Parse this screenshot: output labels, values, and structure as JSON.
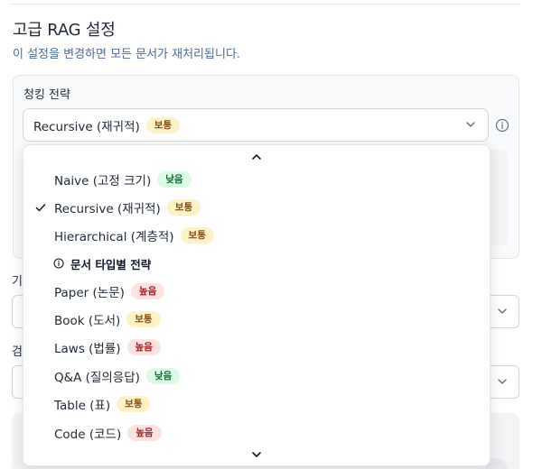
{
  "header": {
    "title": "고급 RAG 설정",
    "subtitle": "이 설정을 변경하면 모든 문서가 재처리됩니다."
  },
  "chunking": {
    "label": "청킹 전략",
    "selected_label": "Recursive (재귀적)",
    "selected_badge": "보통"
  },
  "background": {
    "label_1_partial": "기",
    "label_2_partial": "검"
  },
  "dropdown": {
    "options": [
      {
        "label": "Naive (고정 크기)",
        "badge": "낮음",
        "level": "low",
        "selected": false
      },
      {
        "label": "Recursive (재귀적)",
        "badge": "보통",
        "level": "mid",
        "selected": true
      },
      {
        "label": "Hierarchical (계층적)",
        "badge": "보통",
        "level": "mid",
        "selected": false
      }
    ],
    "group_label": "문서 타입별 전략",
    "typed_options": [
      {
        "label": "Paper (논문)",
        "badge": "높음",
        "level": "high"
      },
      {
        "label": "Book (도서)",
        "badge": "보통",
        "level": "mid"
      },
      {
        "label": "Laws (법률)",
        "badge": "높음",
        "level": "high"
      },
      {
        "label": "Q&A (질의응답)",
        "badge": "낮음",
        "level": "low"
      },
      {
        "label": "Table (표)",
        "badge": "보통",
        "level": "mid"
      },
      {
        "label": "Code (코드)",
        "badge": "높음",
        "level": "high"
      }
    ]
  },
  "colors": {
    "badge_mid_bg": "#fef3c7",
    "badge_low_bg": "#dcfce7",
    "badge_high_bg": "#fde2e2",
    "subtitle": "#4b6a9b"
  },
  "icons": {
    "select_chevron": "chevron-down-icon",
    "info": "info-circle-icon",
    "check": "check-icon",
    "scroll_up": "chevron-up-icon",
    "scroll_down": "chevron-down-icon"
  }
}
